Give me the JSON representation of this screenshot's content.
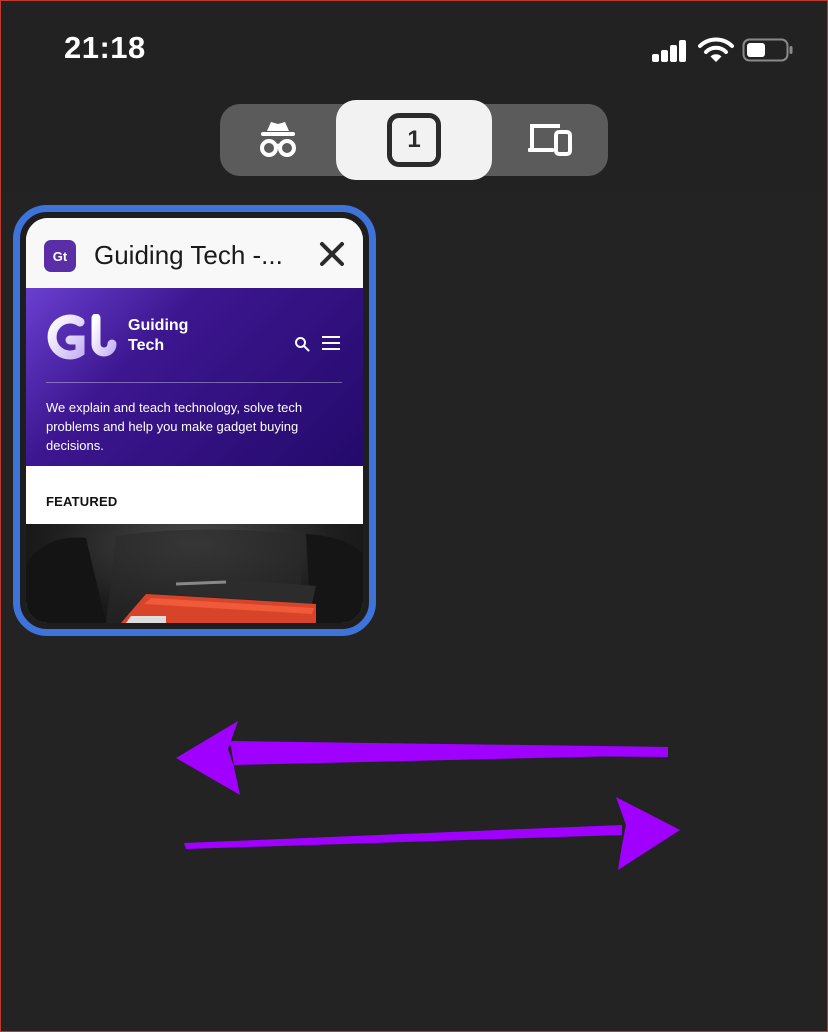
{
  "status_bar": {
    "time": "21:18"
  },
  "tab_switcher": {
    "tab_count": "1",
    "icons": [
      "incognito-icon",
      "tabs-icon",
      "devices-icon"
    ]
  },
  "tab_card": {
    "favicon_text": "Gt",
    "title": "Guiding Tech -...",
    "close_icon": "close-icon",
    "accent_color": "#3e73d9",
    "preview": {
      "brand_line1": "Guiding",
      "brand_line2": "Tech",
      "tagline": "We explain and teach technology, solve tech problems and help you make gadget buying decisions.",
      "featured_label": "FEATURED"
    }
  },
  "annotation": {
    "arrow_color": "#a000ff",
    "arrows": [
      "arrow-left-icon",
      "arrow-right-icon"
    ]
  }
}
